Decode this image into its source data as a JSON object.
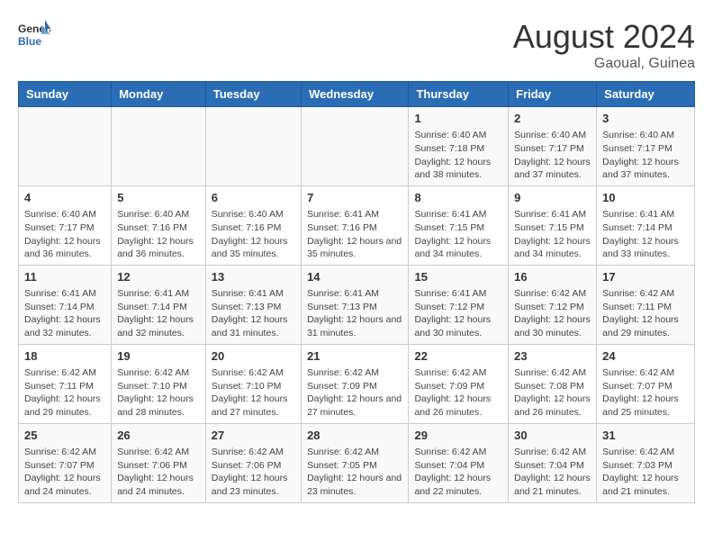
{
  "logo": {
    "line1": "General",
    "line2": "Blue"
  },
  "title": "August 2024",
  "subtitle": "Gaoual, Guinea",
  "days_of_week": [
    "Sunday",
    "Monday",
    "Tuesday",
    "Wednesday",
    "Thursday",
    "Friday",
    "Saturday"
  ],
  "weeks": [
    [
      {
        "day": "",
        "info": ""
      },
      {
        "day": "",
        "info": ""
      },
      {
        "day": "",
        "info": ""
      },
      {
        "day": "",
        "info": ""
      },
      {
        "day": "1",
        "info": "Sunrise: 6:40 AM\nSunset: 7:18 PM\nDaylight: 12 hours and 38 minutes."
      },
      {
        "day": "2",
        "info": "Sunrise: 6:40 AM\nSunset: 7:17 PM\nDaylight: 12 hours and 37 minutes."
      },
      {
        "day": "3",
        "info": "Sunrise: 6:40 AM\nSunset: 7:17 PM\nDaylight: 12 hours and 37 minutes."
      }
    ],
    [
      {
        "day": "4",
        "info": "Sunrise: 6:40 AM\nSunset: 7:17 PM\nDaylight: 12 hours and 36 minutes."
      },
      {
        "day": "5",
        "info": "Sunrise: 6:40 AM\nSunset: 7:16 PM\nDaylight: 12 hours and 36 minutes."
      },
      {
        "day": "6",
        "info": "Sunrise: 6:40 AM\nSunset: 7:16 PM\nDaylight: 12 hours and 35 minutes."
      },
      {
        "day": "7",
        "info": "Sunrise: 6:41 AM\nSunset: 7:16 PM\nDaylight: 12 hours and 35 minutes."
      },
      {
        "day": "8",
        "info": "Sunrise: 6:41 AM\nSunset: 7:15 PM\nDaylight: 12 hours and 34 minutes."
      },
      {
        "day": "9",
        "info": "Sunrise: 6:41 AM\nSunset: 7:15 PM\nDaylight: 12 hours and 34 minutes."
      },
      {
        "day": "10",
        "info": "Sunrise: 6:41 AM\nSunset: 7:14 PM\nDaylight: 12 hours and 33 minutes."
      }
    ],
    [
      {
        "day": "11",
        "info": "Sunrise: 6:41 AM\nSunset: 7:14 PM\nDaylight: 12 hours and 32 minutes."
      },
      {
        "day": "12",
        "info": "Sunrise: 6:41 AM\nSunset: 7:14 PM\nDaylight: 12 hours and 32 minutes."
      },
      {
        "day": "13",
        "info": "Sunrise: 6:41 AM\nSunset: 7:13 PM\nDaylight: 12 hours and 31 minutes."
      },
      {
        "day": "14",
        "info": "Sunrise: 6:41 AM\nSunset: 7:13 PM\nDaylight: 12 hours and 31 minutes."
      },
      {
        "day": "15",
        "info": "Sunrise: 6:41 AM\nSunset: 7:12 PM\nDaylight: 12 hours and 30 minutes."
      },
      {
        "day": "16",
        "info": "Sunrise: 6:42 AM\nSunset: 7:12 PM\nDaylight: 12 hours and 30 minutes."
      },
      {
        "day": "17",
        "info": "Sunrise: 6:42 AM\nSunset: 7:11 PM\nDaylight: 12 hours and 29 minutes."
      }
    ],
    [
      {
        "day": "18",
        "info": "Sunrise: 6:42 AM\nSunset: 7:11 PM\nDaylight: 12 hours and 29 minutes."
      },
      {
        "day": "19",
        "info": "Sunrise: 6:42 AM\nSunset: 7:10 PM\nDaylight: 12 hours and 28 minutes."
      },
      {
        "day": "20",
        "info": "Sunrise: 6:42 AM\nSunset: 7:10 PM\nDaylight: 12 hours and 27 minutes."
      },
      {
        "day": "21",
        "info": "Sunrise: 6:42 AM\nSunset: 7:09 PM\nDaylight: 12 hours and 27 minutes."
      },
      {
        "day": "22",
        "info": "Sunrise: 6:42 AM\nSunset: 7:09 PM\nDaylight: 12 hours and 26 minutes."
      },
      {
        "day": "23",
        "info": "Sunrise: 6:42 AM\nSunset: 7:08 PM\nDaylight: 12 hours and 26 minutes."
      },
      {
        "day": "24",
        "info": "Sunrise: 6:42 AM\nSunset: 7:07 PM\nDaylight: 12 hours and 25 minutes."
      }
    ],
    [
      {
        "day": "25",
        "info": "Sunrise: 6:42 AM\nSunset: 7:07 PM\nDaylight: 12 hours and 24 minutes."
      },
      {
        "day": "26",
        "info": "Sunrise: 6:42 AM\nSunset: 7:06 PM\nDaylight: 12 hours and 24 minutes."
      },
      {
        "day": "27",
        "info": "Sunrise: 6:42 AM\nSunset: 7:06 PM\nDaylight: 12 hours and 23 minutes."
      },
      {
        "day": "28",
        "info": "Sunrise: 6:42 AM\nSunset: 7:05 PM\nDaylight: 12 hours and 23 minutes."
      },
      {
        "day": "29",
        "info": "Sunrise: 6:42 AM\nSunset: 7:04 PM\nDaylight: 12 hours and 22 minutes."
      },
      {
        "day": "30",
        "info": "Sunrise: 6:42 AM\nSunset: 7:04 PM\nDaylight: 12 hours and 21 minutes."
      },
      {
        "day": "31",
        "info": "Sunrise: 6:42 AM\nSunset: 7:03 PM\nDaylight: 12 hours and 21 minutes."
      }
    ]
  ]
}
